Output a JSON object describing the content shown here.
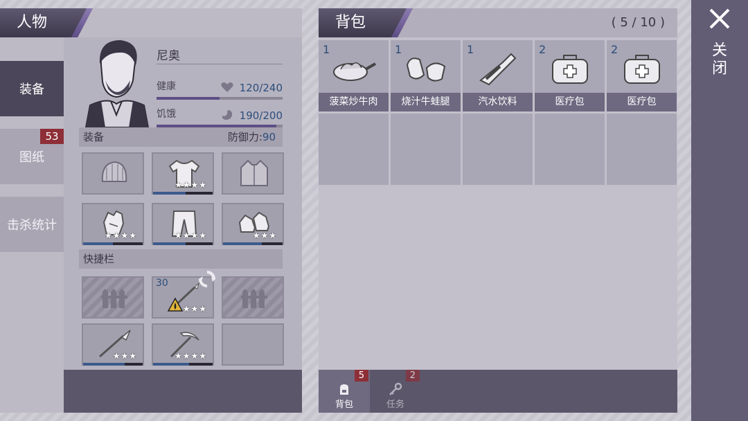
{
  "character_panel": {
    "title": "人物",
    "tabs": [
      {
        "label": "装备",
        "active": true
      },
      {
        "label": "图纸",
        "badge": "53"
      },
      {
        "label": "击杀统计"
      }
    ],
    "name": "尼奥",
    "stats": [
      {
        "label": "健康",
        "value": "120/240",
        "icon": "heart-icon",
        "fraction": 0.5
      },
      {
        "label": "饥饿",
        "value": "190/200",
        "icon": "stomach-icon",
        "fraction": 0.95
      }
    ],
    "equipment": {
      "title": "装备",
      "defense_label": "防御力:",
      "defense_value": "90",
      "slots": [
        {
          "icon": "beanie-icon",
          "stars": "",
          "durability": 0
        },
        {
          "icon": "tshirt-icon",
          "stars": "★★★★",
          "durability": 0.55
        },
        {
          "icon": "jacket-icon",
          "stars": "",
          "durability": 0
        },
        {
          "icon": "gloves-icon",
          "stars": "★★★★",
          "durability": 0.5
        },
        {
          "icon": "pants-icon",
          "stars": "★★★★",
          "durability": 0.55
        },
        {
          "icon": "sneakers-icon",
          "stars": "★★★",
          "durability": 0.65
        }
      ]
    },
    "hotbar": {
      "title": "快捷栏",
      "slots": [
        {
          "icon": "fence-placeholder-icon",
          "locked": true
        },
        {
          "icon": "burning-spear-icon",
          "count": "30",
          "stars": "★★★",
          "durability": 0,
          "swap": true
        },
        {
          "icon": "fence-placeholder-icon",
          "locked": true
        },
        {
          "icon": "spear-icon",
          "stars": "★★★",
          "durability": 0.7
        },
        {
          "icon": "pickaxe-icon",
          "stars": "★★★★",
          "durability": 0.6
        },
        {
          "icon": "empty-slot",
          "locked": false
        }
      ]
    }
  },
  "bag_panel": {
    "title": "背包",
    "capacity": "( 5 / 10 )",
    "items": [
      {
        "count": "1",
        "name": "菠菜炒牛肉",
        "icon": "stirfry-pan-icon"
      },
      {
        "count": "1",
        "name": "烧汁牛蛙腿",
        "icon": "frog-legs-icon"
      },
      {
        "count": "1",
        "name": "汽水饮料",
        "icon": "soda-bottle-icon"
      },
      {
        "count": "2",
        "name": "医疗包",
        "icon": "medkit-icon"
      },
      {
        "count": "2",
        "name": "医疗包",
        "icon": "medkit-icon"
      }
    ],
    "tabs": [
      {
        "label": "背包",
        "badge": "5",
        "icon": "backpack-icon",
        "active": true
      },
      {
        "label": "任务",
        "badge": "2",
        "icon": "key-icon",
        "active": false
      }
    ]
  },
  "close": {
    "label": "关闭",
    "icon": "close-icon"
  },
  "colors": {
    "header_dark": "#3d384b",
    "accent_purple": "#6c5a99",
    "badge_red": "#8e2f37",
    "value_blue": "#2c4e7a"
  }
}
